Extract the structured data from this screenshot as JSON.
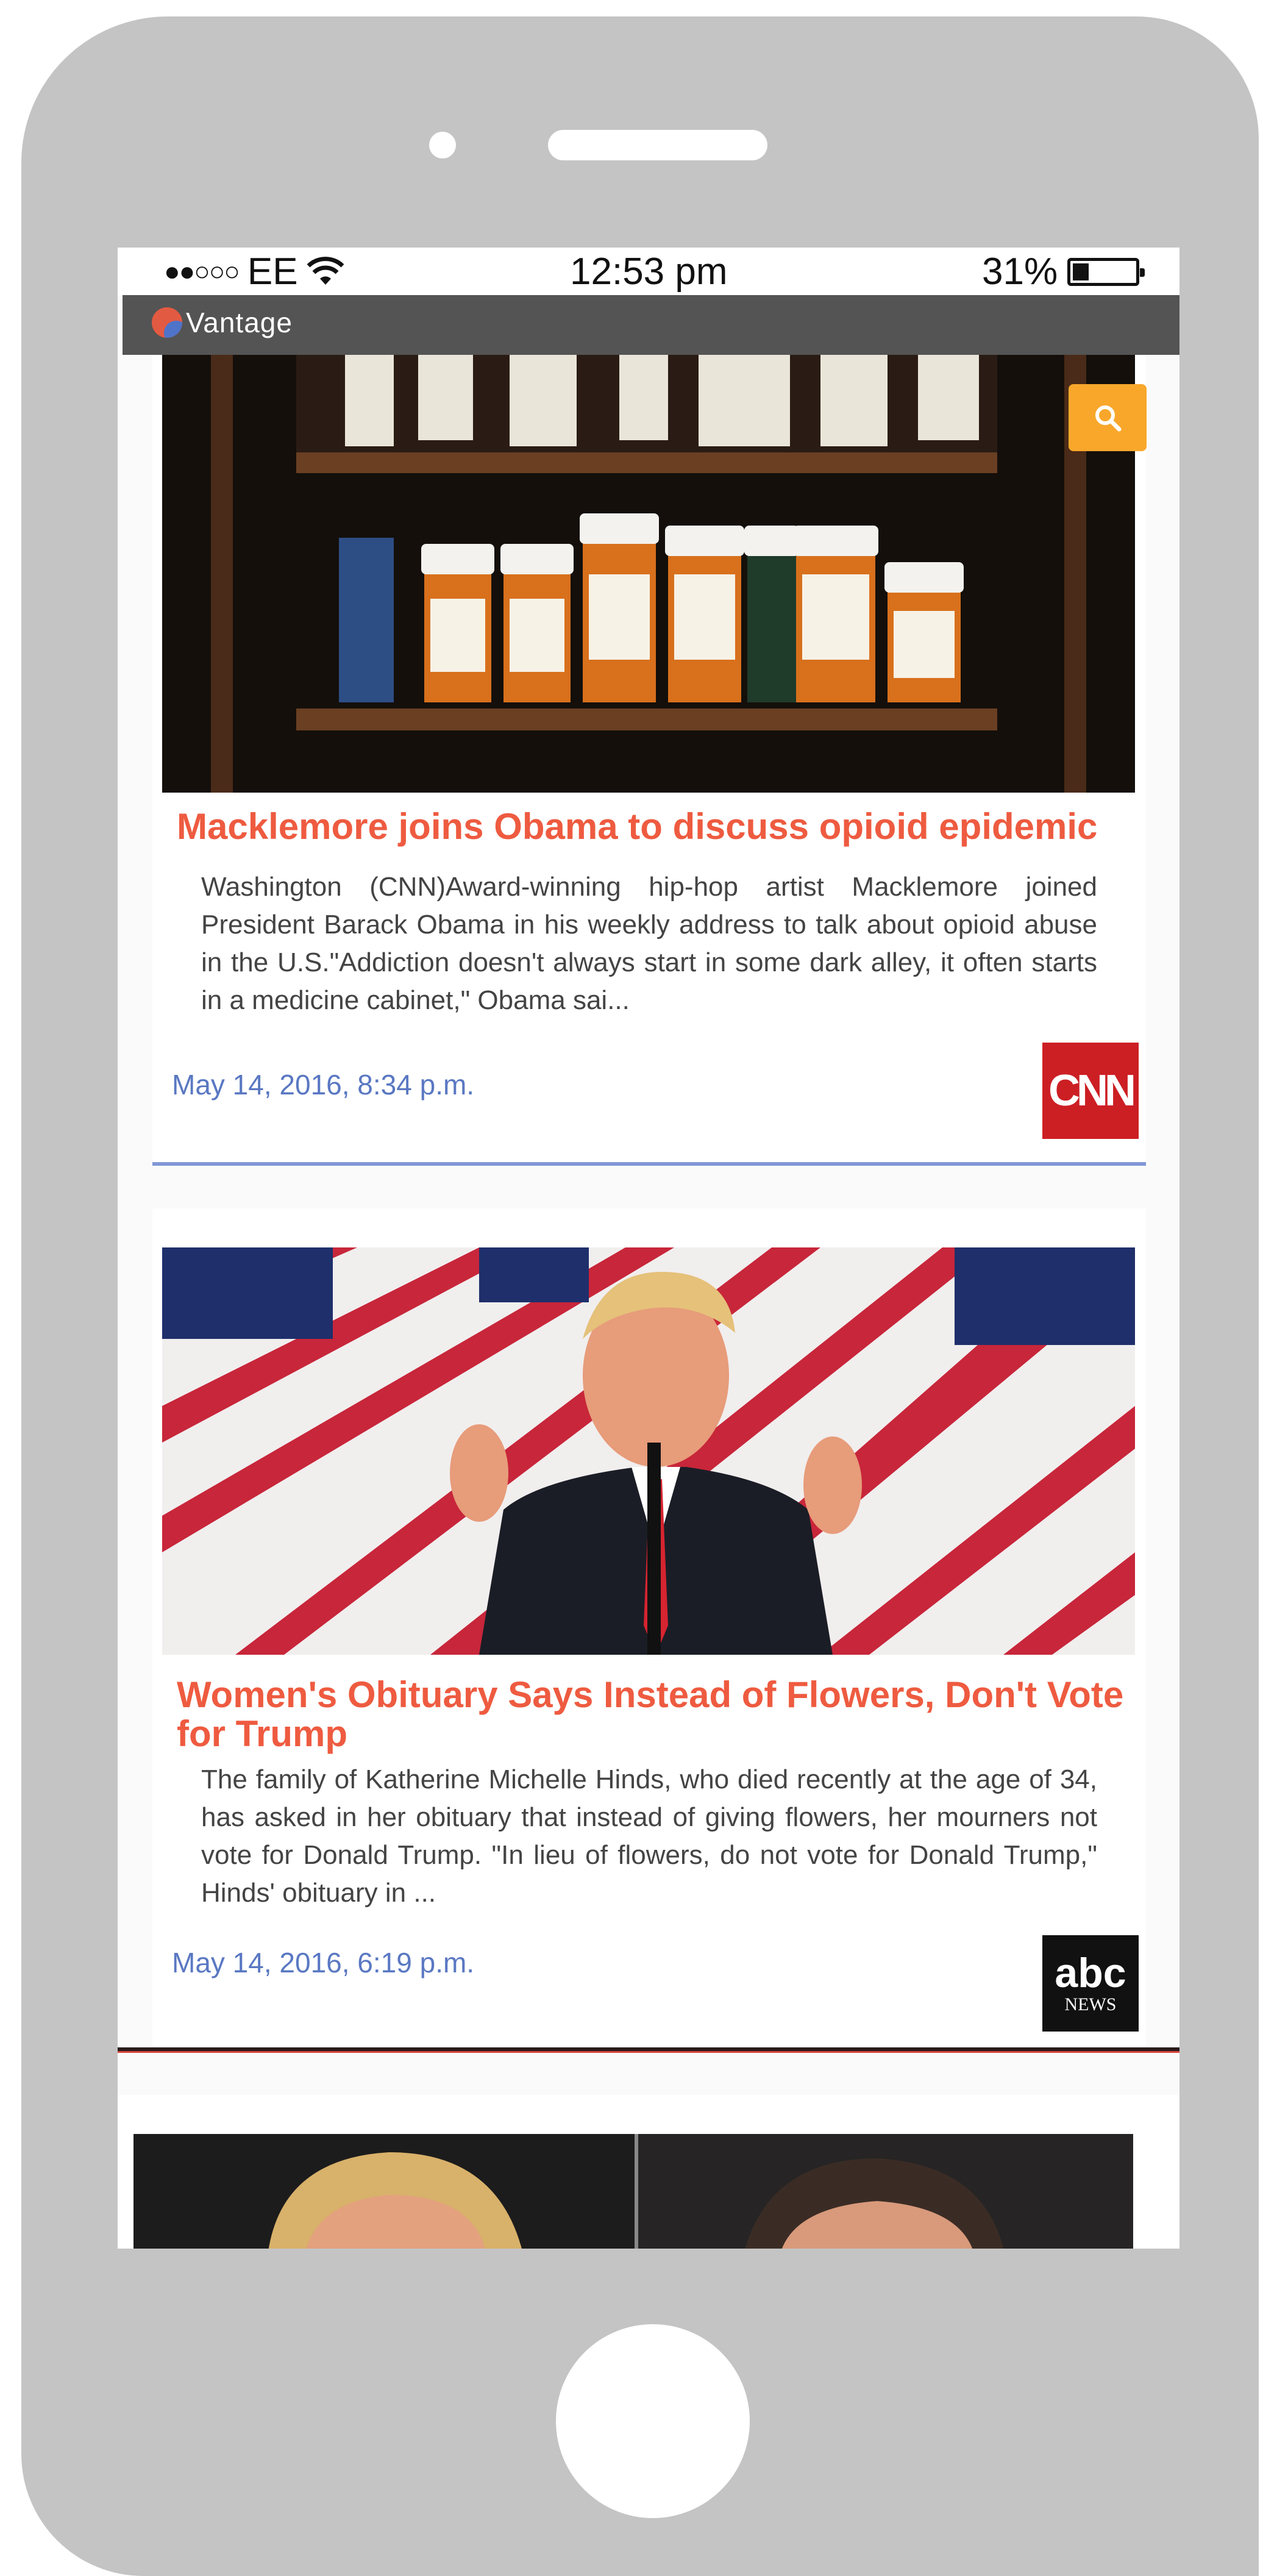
{
  "status_bar": {
    "signal": "●●○○○",
    "carrier": "EE",
    "time": "12:53 pm",
    "battery_percent": "31%",
    "battery_level": 0.31
  },
  "app": {
    "name": "Vantage",
    "search_icon": "magnifier-icon",
    "accent_color": "#f8a72b"
  },
  "articles": [
    {
      "headline": "Macklemore joins Obama to discuss opioid epidemic",
      "summary": "Washington (CNN)Award-winning hip-hop artist Macklemore joined President Barack Obama in his weekly address to talk about opioid abuse in the U.S.\"Addiction doesn't always start in some dark alley, it often starts in a medicine cabinet,\" Obama sai...",
      "datetime": "May 14, 2016, 8:34 p.m.",
      "source_logo": "CNN",
      "image": "pill-bottles-on-shelf"
    },
    {
      "headline": "Women's Obituary Says Instead of Flowers, Don't Vote for Trump",
      "summary": "The family of Katherine Michelle Hinds, who died recently at the age of 34, has asked in her obituary that instead of giving flowers, her mourners not vote for Donald Trump. \"In lieu of flowers, do not vote for Donald Trump,\" Hinds' obituary in ...",
      "datetime": "May 14, 2016, 6:19 p.m.",
      "source_logo_line1": "abc",
      "source_logo_line2": "NEWS",
      "image": "man-speaking-before-flags"
    }
  ],
  "colors": {
    "headline": "#ee5b40",
    "datetime": "#5a78c2",
    "appbar": "#545454"
  }
}
